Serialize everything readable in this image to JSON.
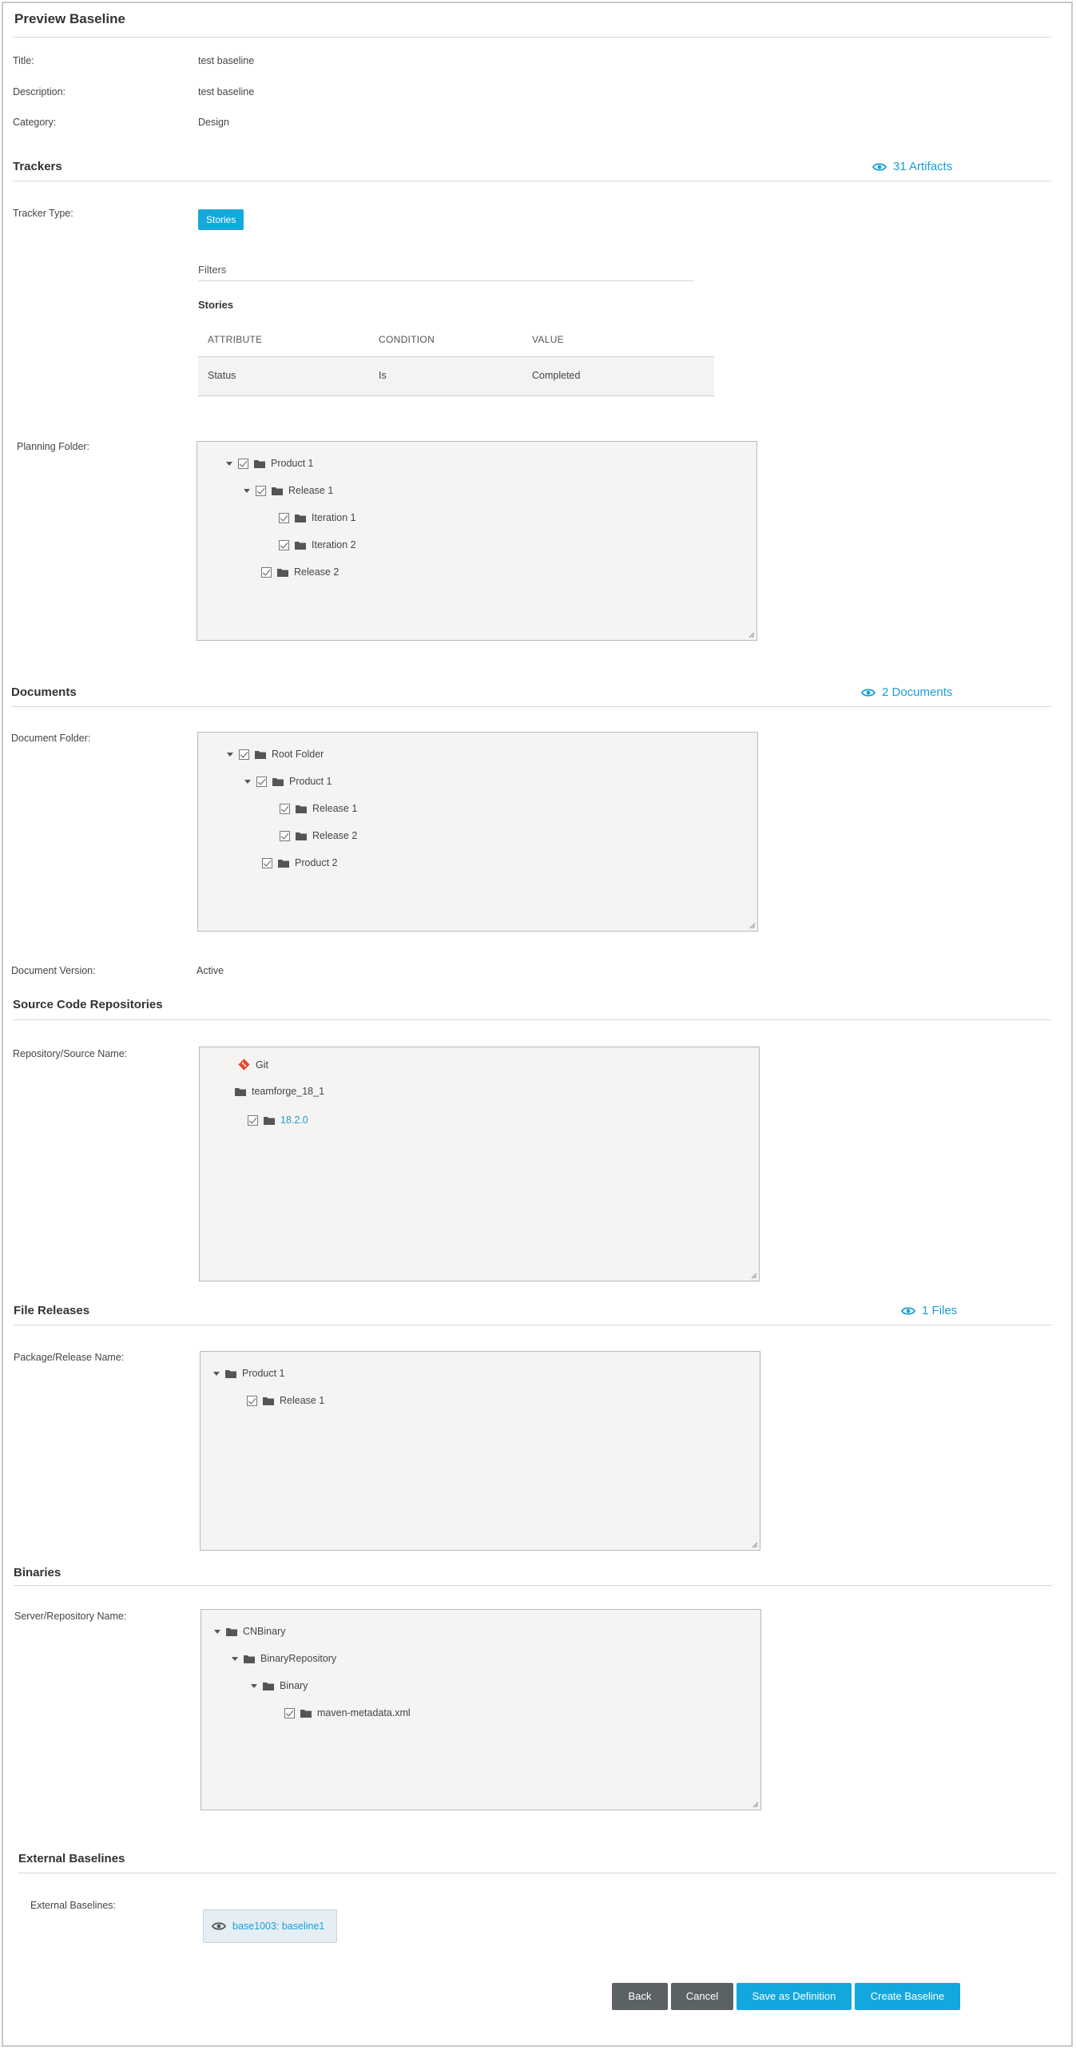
{
  "page": {
    "title": "Preview Baseline"
  },
  "details": {
    "title_label": "Title:",
    "title_value": "test baseline",
    "description_label": "Description:",
    "description_value": "test baseline",
    "category_label": "Category:",
    "category_value": "Design"
  },
  "trackers": {
    "heading": "Trackers",
    "artifacts_link": "31 Artifacts",
    "tracker_type_label": "Tracker Type:",
    "tracker_type_tag": "Stories",
    "filters_label": "Filters",
    "filter_tracker_name": "Stories",
    "table_headers": [
      "ATTRIBUTE",
      "CONDITION",
      "VALUE"
    ],
    "table_row": [
      "Status",
      "Is",
      "Completed"
    ],
    "planning_folder_label": "Planning Folder:",
    "planning_tree": [
      "Product 1",
      "Release 1",
      "Iteration 1",
      "Iteration 2",
      "Release 2"
    ]
  },
  "documents": {
    "heading": "Documents",
    "documents_link": "2 Documents",
    "folder_label": "Document Folder:",
    "folder_tree": [
      "Root Folder",
      "Product 1",
      "Release 1",
      "Release 2",
      "Product 2"
    ],
    "version_label": "Document Version:",
    "version_value": "Active"
  },
  "scm": {
    "heading": "Source Code Repositories",
    "repo_label": "Repository/Source Name:",
    "tree": [
      "Git",
      "teamforge_18_1",
      "18.2.0"
    ]
  },
  "file_releases": {
    "heading": "File Releases",
    "files_link": "1 Files",
    "package_label": "Package/Release Name:",
    "tree": [
      "Product 1",
      "Release 1"
    ]
  },
  "binaries": {
    "heading": "Binaries",
    "server_label": "Server/Repository Name:",
    "tree": [
      "CNBinary",
      "BinaryRepository",
      "Binary",
      "maven-metadata.xml"
    ]
  },
  "external": {
    "heading": "External Baselines",
    "label": "External Baselines:",
    "chip": "base1003: baseline1"
  },
  "actions": {
    "back": "Back",
    "cancel": "Cancel",
    "save_definition": "Save as Definition",
    "create": "Create Baseline"
  },
  "colors": {
    "accent": "#14a9dd",
    "dark_button": "#5b6266",
    "git": "#e8452c"
  }
}
